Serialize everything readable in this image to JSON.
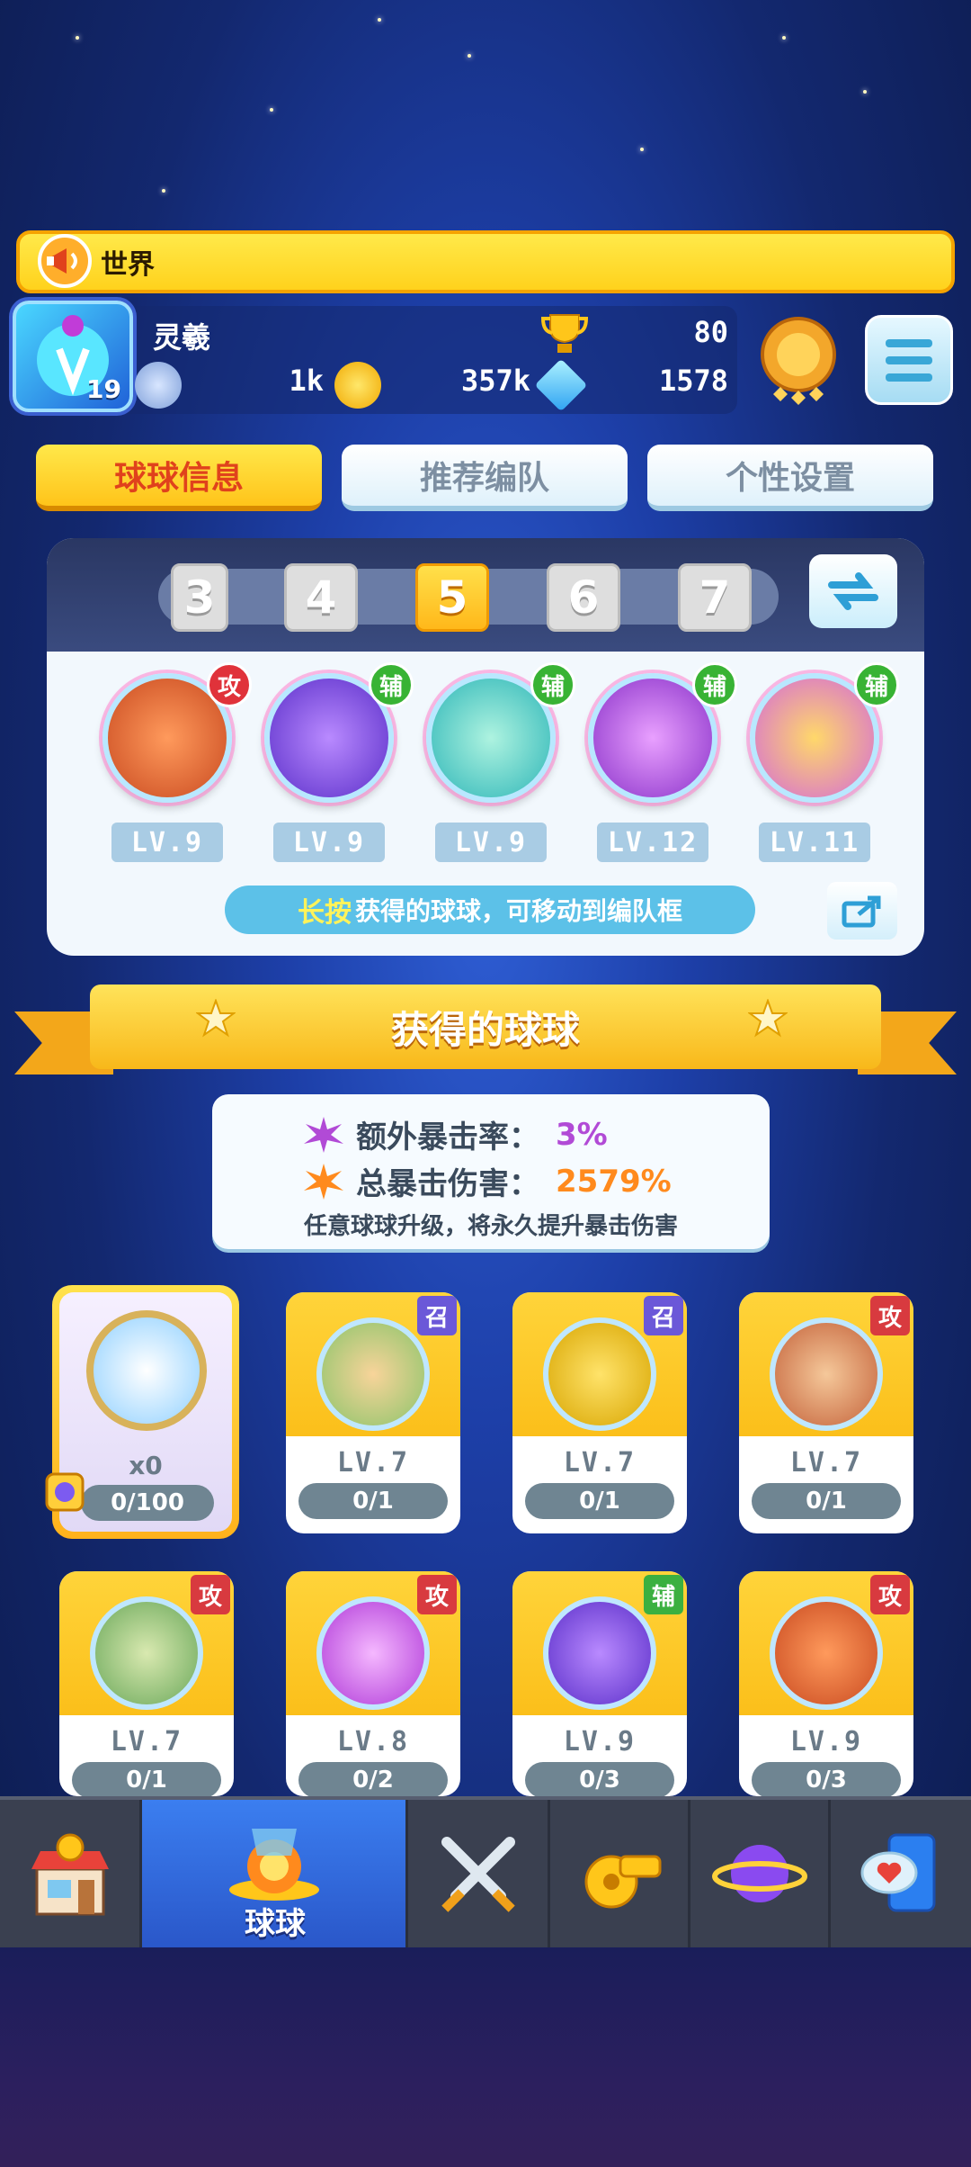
{
  "chat": {
    "label": "世界"
  },
  "player": {
    "name": "灵羲",
    "level": "19",
    "trophies": "80",
    "silver": "1k",
    "gold": "357k",
    "gems": "1578"
  },
  "tabs": [
    {
      "label": "球球信息",
      "active": true
    },
    {
      "label": "推荐编队",
      "active": false
    },
    {
      "label": "个性设置",
      "active": false
    }
  ],
  "team": {
    "slots": [
      "3",
      "4",
      "5",
      "6",
      "7"
    ],
    "selected_slot": "5",
    "balls": [
      {
        "role": "攻",
        "level": "LV.9",
        "icon": "infinity-ball-icon"
      },
      {
        "role": "辅",
        "level": "LV.9",
        "icon": "lightning-ball-icon"
      },
      {
        "role": "辅",
        "level": "LV.9",
        "icon": "dragon-ball-icon"
      },
      {
        "role": "辅",
        "level": "LV.12",
        "icon": "sprout-ball-icon"
      },
      {
        "role": "辅",
        "level": "LV.11",
        "icon": "people-ball-icon"
      }
    ],
    "hint_highlight": "长按",
    "hint_text": "获得的球球，可移动到编队框"
  },
  "owned": {
    "title": "获得的球球",
    "crit_rate_label": "额外暴击率：",
    "crit_rate_value": "3%",
    "crit_damage_label": "总暴击伤害：",
    "crit_damage_value": "2579%",
    "note": "任意球球升级，将永久提升暴击伤害"
  },
  "special_card": {
    "count": "x0",
    "progress": "0/100"
  },
  "cards": [
    {
      "role": "召",
      "level": "LV.7",
      "count": "0/1",
      "icon": "monkey-ball-icon"
    },
    {
      "role": "召",
      "level": "LV.7",
      "count": "0/1",
      "icon": "dog-ball-icon"
    },
    {
      "role": "攻",
      "level": "LV.7",
      "count": "0/1",
      "icon": "bear-ball-icon"
    },
    {
      "role": "攻",
      "level": "LV.7",
      "count": "0/1",
      "icon": "hunter-ball-icon"
    },
    {
      "role": "攻",
      "level": "LV.8",
      "count": "0/2",
      "icon": "fish-ball-icon"
    },
    {
      "role": "辅",
      "level": "LV.9",
      "count": "0/3",
      "icon": "lightning-ball-icon"
    },
    {
      "role": "攻",
      "level": "LV.9",
      "count": "0/3",
      "icon": "infinity-ball-icon"
    }
  ],
  "nav": {
    "items": [
      {
        "icon": "shop-icon"
      },
      {
        "icon": "balls-icon",
        "label": "球球",
        "active": true
      },
      {
        "icon": "battle-swords-icon"
      },
      {
        "icon": "whistle-icon"
      },
      {
        "icon": "planet-icon"
      },
      {
        "icon": "social-chat-icon"
      }
    ]
  },
  "colors": {
    "accent_yellow": "#ffd21c",
    "attack_red": "#d83a3f",
    "support_green": "#3bb040",
    "summon_purple": "#6b58d8",
    "nav_active_blue": "#2f6ae0"
  }
}
